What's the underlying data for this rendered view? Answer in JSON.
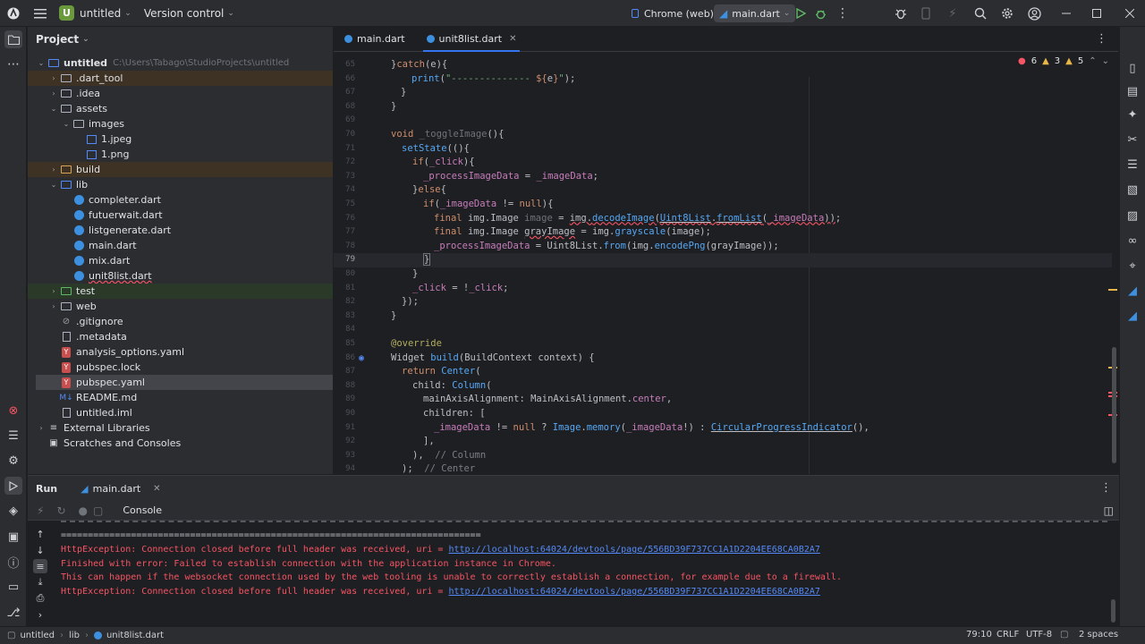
{
  "titlebar": {
    "project_badge": "U",
    "project_name": "untitled",
    "vcs": "Version control",
    "device": "Chrome (web)",
    "run_config": "main.dart"
  },
  "project_panel": {
    "title": "Project",
    "root_name": "untitled",
    "root_path": "C:\\Users\\Tabago\\StudioProjects\\untitled",
    "items": [
      {
        "label": ".dart_tool"
      },
      {
        "label": ".idea"
      },
      {
        "label": "assets"
      },
      {
        "label": "images"
      },
      {
        "label": "1.jpeg"
      },
      {
        "label": "1.png"
      },
      {
        "label": "build"
      },
      {
        "label": "lib"
      },
      {
        "label": "completer.dart"
      },
      {
        "label": "futuerwait.dart"
      },
      {
        "label": "listgenerate.dart"
      },
      {
        "label": "main.dart"
      },
      {
        "label": "mix.dart"
      },
      {
        "label": "unit8list.dart"
      },
      {
        "label": "test"
      },
      {
        "label": "web"
      },
      {
        "label": ".gitignore"
      },
      {
        "label": ".metadata"
      },
      {
        "label": "analysis_options.yaml"
      },
      {
        "label": "pubspec.lock"
      },
      {
        "label": "pubspec.yaml"
      },
      {
        "label": "README.md"
      },
      {
        "label": "untitled.iml"
      },
      {
        "label": "External Libraries"
      },
      {
        "label": "Scratches and Consoles"
      }
    ]
  },
  "editor": {
    "tabs": [
      {
        "label": "main.dart"
      },
      {
        "label": "unit8list.dart"
      }
    ],
    "inspections": {
      "errors": "6",
      "warnings": "3",
      "weak": "5"
    },
    "line_numbers": [
      "65",
      "66",
      "67",
      "68",
      "69",
      "70",
      "71",
      "72",
      "73",
      "74",
      "75",
      "76",
      "77",
      "78",
      "79",
      "80",
      "81",
      "82",
      "83",
      "84",
      "85",
      "86",
      "87",
      "88",
      "89",
      "90",
      "91",
      "92",
      "93",
      "94"
    ],
    "code_lines": [
      "}catch(e){",
      "  print(\"-------------- ${e}\");",
      "}",
      "}",
      "",
      "void _toggleImage(){",
      "  setState((){",
      "    if(_click){",
      "      _processImageData = _imageData;",
      "    }else{",
      "      if(_imageData != null){",
      "        final img.Image image = img.decodeImage(Uint8List.fromList(_imageData));",
      "        final img.Image grayImage = img.grayscale(image);",
      "        _processImageData = Uint8List.from(img.encodePng(grayImage));",
      "      }",
      "    }",
      "    _click = !_click;",
      "  });",
      "}",
      "",
      "@override",
      "Widget build(BuildContext context) {",
      "  return Center(",
      "    child: Column(",
      "      mainAxisAlignment: MainAxisAlignment.center,",
      "      children: [",
      "        _imageData != null ? Image.memory(_imageData!) : CircularProgressIndicator(),",
      "      ],",
      "    ),  // Column",
      "  );  // Center"
    ]
  },
  "run_panel": {
    "title": "Run",
    "tab": "main.dart",
    "console_label": "Console",
    "lines": [
      {
        "text": "==============================================================================",
        "kind": "sep"
      },
      {
        "prefix": "HttpException: Connection closed before full header was received, uri = ",
        "link": "http://localhost:64024/devtools/page/556BD39F737CC1A1D2204EE68CA0B2A7",
        "kind": "err"
      },
      {
        "prefix": "Finished with error: Failed to establish connection with the application instance in Chrome.",
        "link": "",
        "kind": "err"
      },
      {
        "prefix": "This can happen if the websocket connection used by the web tooling is unable to correctly establish a connection, for example due to a firewall.",
        "link": "",
        "kind": "err"
      },
      {
        "prefix": "HttpException: Connection closed before full header was received, uri = ",
        "link": "http://localhost:64024/devtools/page/556BD39F737CC1A1D2204EE68CA0B2A7",
        "kind": "err"
      }
    ]
  },
  "statusbar": {
    "crumbs": [
      "untitled",
      "lib",
      "unit8list.dart"
    ],
    "position": "79:10",
    "line_ending": "CRLF",
    "encoding": "UTF-8",
    "indent": "2 spaces"
  },
  "colors": {
    "accent": "#3574f0",
    "error": "#f75464",
    "link": "#548af7"
  }
}
